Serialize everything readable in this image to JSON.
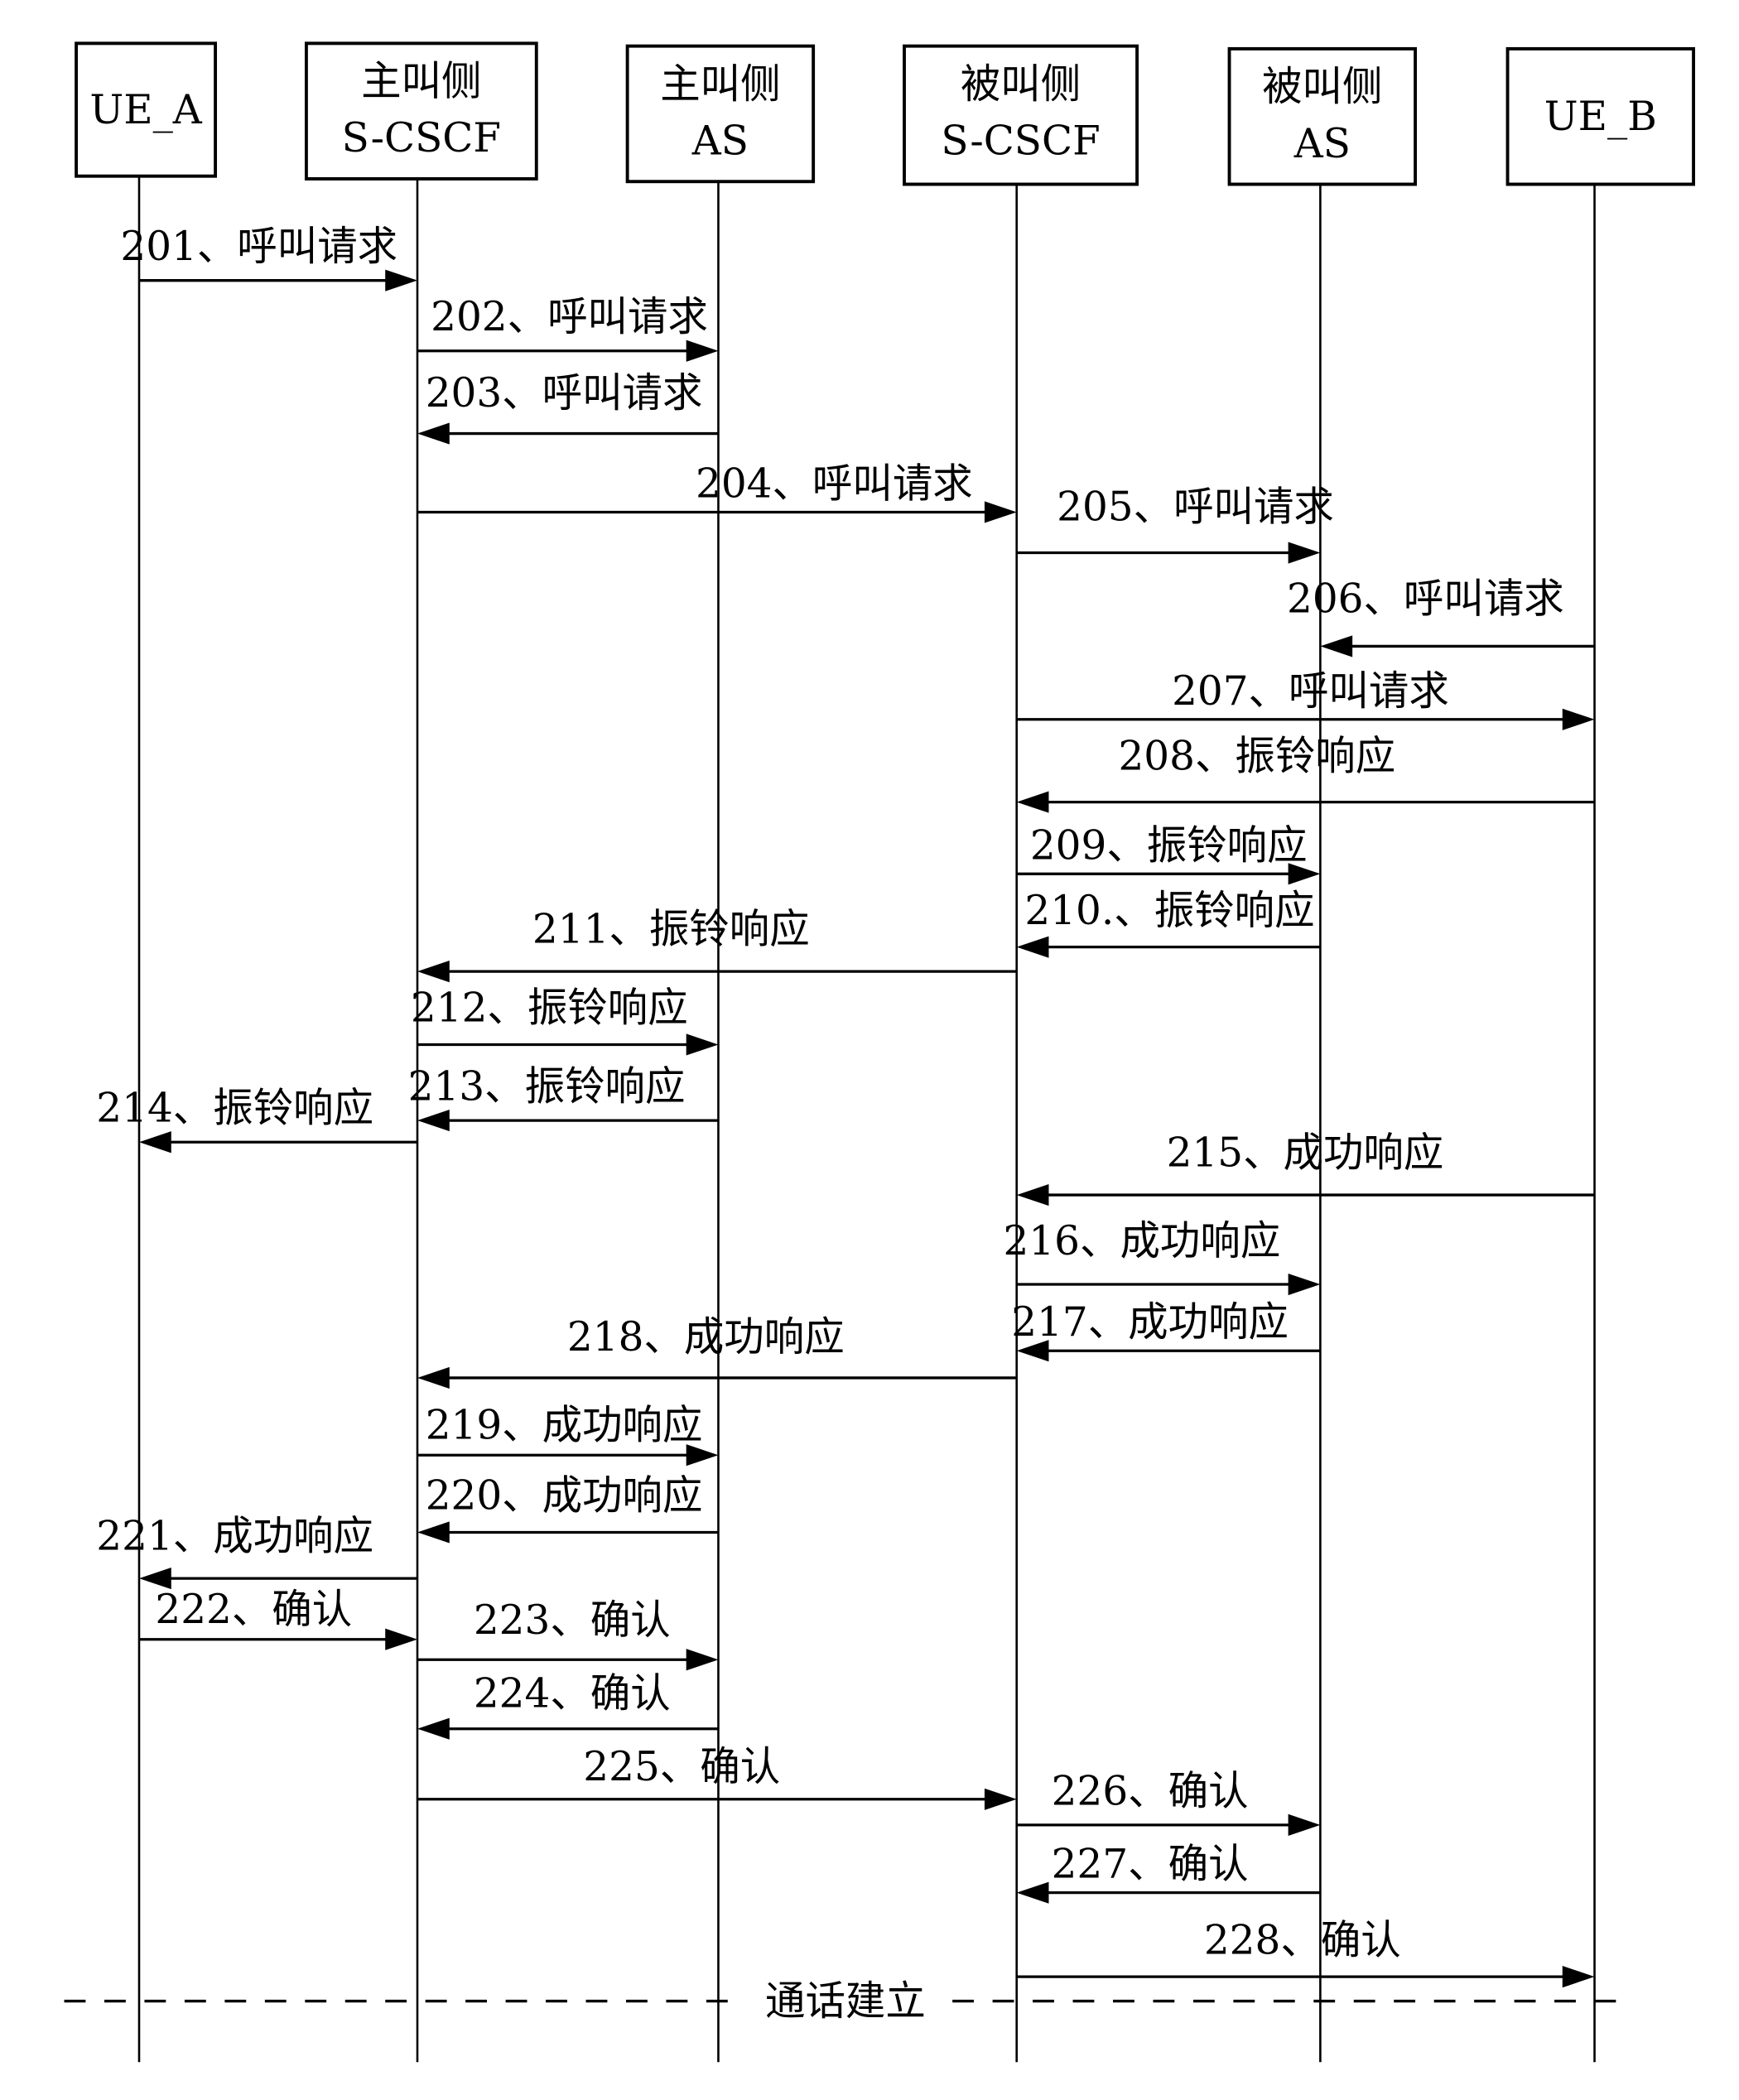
{
  "participants": [
    {
      "id": "ue_a",
      "lines": [
        "UE_A"
      ]
    },
    {
      "id": "orig_scscf",
      "lines": [
        "主叫侧",
        "S-CSCF"
      ]
    },
    {
      "id": "orig_as",
      "lines": [
        "主叫侧",
        "AS"
      ]
    },
    {
      "id": "term_scscf",
      "lines": [
        "被叫侧",
        "S-CSCF"
      ]
    },
    {
      "id": "term_as",
      "lines": [
        "被叫侧",
        "AS"
      ]
    },
    {
      "id": "ue_b",
      "lines": [
        "UE_B"
      ]
    }
  ],
  "messages": [
    {
      "label": "201、呼叫请求",
      "from": "ue_a",
      "to": "orig_scscf"
    },
    {
      "label": "202、呼叫请求",
      "from": "orig_scscf",
      "to": "orig_as"
    },
    {
      "label": "203、呼叫请求",
      "from": "orig_as",
      "to": "orig_scscf"
    },
    {
      "label": "204、呼叫请求",
      "from": "orig_scscf",
      "to": "term_scscf"
    },
    {
      "label": "205、呼叫请求",
      "from": "term_scscf",
      "to": "term_as"
    },
    {
      "label": "206、呼叫请求",
      "from": "ue_b",
      "to": "term_as"
    },
    {
      "label": "207、呼叫请求",
      "from": "term_scscf",
      "to": "ue_b"
    },
    {
      "label": "208、振铃响应",
      "from": "ue_b",
      "to": "term_scscf"
    },
    {
      "label": "209、振铃响应",
      "from": "term_scscf",
      "to": "term_as"
    },
    {
      "label": "210.、振铃响应",
      "from": "term_as",
      "to": "term_scscf"
    },
    {
      "label": "211、振铃响应",
      "from": "term_scscf",
      "to": "orig_scscf"
    },
    {
      "label": "212、振铃响应",
      "from": "orig_scscf",
      "to": "orig_as"
    },
    {
      "label": "213、振铃响应",
      "from": "orig_as",
      "to": "orig_scscf"
    },
    {
      "label": "214、振铃响应",
      "from": "orig_scscf",
      "to": "ue_a"
    },
    {
      "label": "215、成功响应",
      "from": "ue_b",
      "to": "term_scscf"
    },
    {
      "label": "216、成功响应",
      "from": "term_scscf",
      "to": "term_as"
    },
    {
      "label": "217、成功响应",
      "from": "term_as",
      "to": "term_scscf"
    },
    {
      "label": "218、成功响应",
      "from": "term_scscf",
      "to": "orig_scscf"
    },
    {
      "label": "219、成功响应",
      "from": "orig_scscf",
      "to": "orig_as"
    },
    {
      "label": "220、成功响应",
      "from": "orig_as",
      "to": "orig_scscf"
    },
    {
      "label": "221、成功响应",
      "from": "orig_scscf",
      "to": "ue_a"
    },
    {
      "label": "222、确认",
      "from": "ue_a",
      "to": "orig_scscf"
    },
    {
      "label": "223、确认",
      "from": "orig_scscf",
      "to": "orig_as"
    },
    {
      "label": "224、确认",
      "from": "orig_as",
      "to": "orig_scscf"
    },
    {
      "label": "225、确认",
      "from": "orig_scscf",
      "to": "term_scscf"
    },
    {
      "label": "226、确认",
      "from": "term_scscf",
      "to": "term_as"
    },
    {
      "label": "227、确认",
      "from": "term_as",
      "to": "term_scscf"
    },
    {
      "label": "228、确认",
      "from": "term_scscf",
      "to": "ue_b"
    }
  ],
  "divider": {
    "label": "通话建立"
  }
}
